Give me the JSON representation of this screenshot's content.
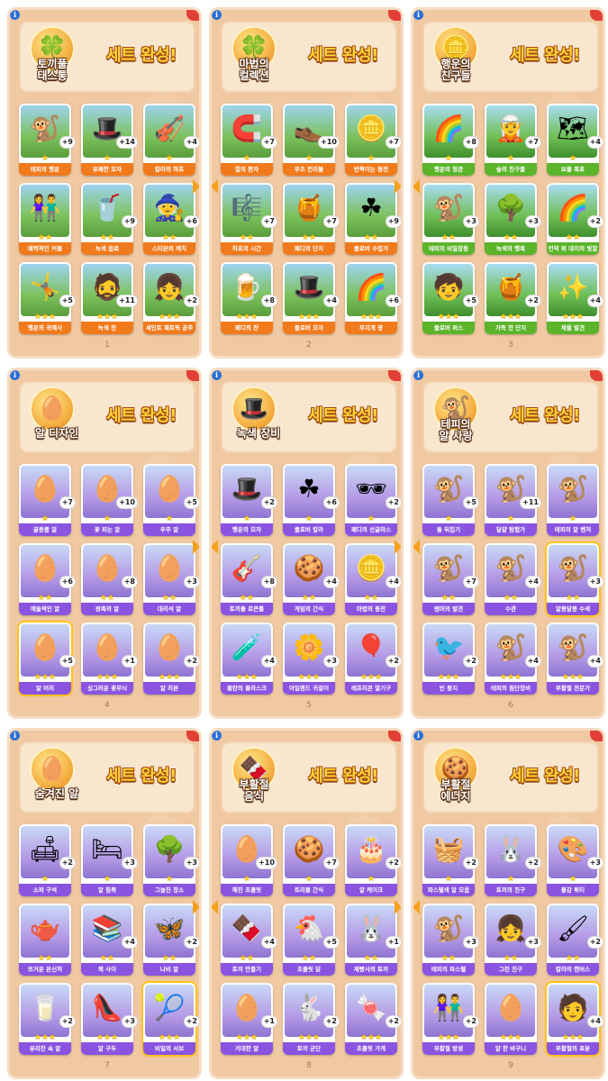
{
  "complete_label": "세트 완성!",
  "star": "★",
  "panels": [
    {
      "page": "1",
      "set_name": "토끼풀\n태스통",
      "icon": "leprechaun-duo-icon",
      "glyph": "🍀",
      "cards": [
        {
          "name": "테피의 행운",
          "dup": "+9",
          "stars": 1,
          "color": "orange",
          "emoji": "🐒",
          "gold": false
        },
        {
          "name": "유쾌한 모자",
          "dup": "+14",
          "stars": 1,
          "color": "orange",
          "emoji": "🎩",
          "gold": false
        },
        {
          "name": "칼라의 하프",
          "dup": "+4",
          "stars": 1,
          "color": "orange",
          "emoji": "🎻",
          "gold": false
        },
        {
          "name": "매력적인 커플",
          "dup": "",
          "stars": 2,
          "color": "orange",
          "emoji": "👫",
          "gold": false
        },
        {
          "name": "녹색 음료",
          "dup": "+9",
          "stars": 2,
          "color": "orange",
          "emoji": "🥤",
          "gold": false
        },
        {
          "name": "스티븐의 캐치",
          "dup": "+6",
          "stars": 2,
          "color": "orange",
          "emoji": "🧙",
          "gold": false
        },
        {
          "name": "행운의 곡예사",
          "dup": "+5",
          "stars": 3,
          "color": "orange",
          "emoji": "🤸",
          "gold": false
        },
        {
          "name": "녹색 잔",
          "dup": "+11",
          "stars": 3,
          "color": "orange",
          "emoji": "🧔",
          "gold": false
        },
        {
          "name": "세인트 패트릭 공주",
          "dup": "+2",
          "stars": 3,
          "color": "orange",
          "emoji": "👧",
          "gold": false
        }
      ]
    },
    {
      "page": "2",
      "set_name": "마법의\n컬렉션",
      "icon": "four-leaf-clover-icon",
      "glyph": "🍀",
      "cards": [
        {
          "name": "힘의 편자",
          "dup": "+7",
          "stars": 1,
          "color": "orange",
          "emoji": "🧲",
          "gold": false
        },
        {
          "name": "부츠 컨리볼",
          "dup": "+10",
          "stars": 1,
          "color": "orange",
          "emoji": "👞",
          "gold": false
        },
        {
          "name": "반짝이는 동전",
          "dup": "+7",
          "stars": 1,
          "color": "orange",
          "emoji": "🪙",
          "gold": false
        },
        {
          "name": "하프의 시간",
          "dup": "+7",
          "stars": 2,
          "color": "orange",
          "emoji": "🎼",
          "gold": false
        },
        {
          "name": "패디의 단지",
          "dup": "+7",
          "stars": 2,
          "color": "orange",
          "emoji": "🍯",
          "gold": false
        },
        {
          "name": "클로버 수집가",
          "dup": "+9",
          "stars": 2,
          "color": "orange",
          "emoji": "☘",
          "gold": false
        },
        {
          "name": "패디의 잔",
          "dup": "+8",
          "stars": 3,
          "color": "orange",
          "emoji": "🍺",
          "gold": false
        },
        {
          "name": "클로버 모자",
          "dup": "+4",
          "stars": 3,
          "color": "orange",
          "emoji": "🎩",
          "gold": false
        },
        {
          "name": "무지개 광",
          "dup": "+6",
          "stars": 3,
          "color": "orange",
          "emoji": "🌈",
          "gold": false
        }
      ]
    },
    {
      "page": "3",
      "set_name": "행운의\n친구들",
      "icon": "pot-of-gold-icon",
      "glyph": "🪙",
      "cards": [
        {
          "name": "행운의 정관",
          "dup": "+8",
          "stars": 1,
          "color": "green",
          "emoji": "🌈",
          "gold": false
        },
        {
          "name": "숲의 친구들",
          "dup": "+7",
          "stars": 1,
          "color": "green",
          "emoji": "🧝",
          "gold": false
        },
        {
          "name": "보물 목표",
          "dup": "+4",
          "stars": 1,
          "color": "green",
          "emoji": "🗺",
          "gold": false
        },
        {
          "name": "테피의 비밀장용",
          "dup": "+3",
          "stars": 2,
          "color": "green",
          "emoji": "🐒",
          "gold": false
        },
        {
          "name": "녹색의 행복",
          "dup": "+3",
          "stars": 2,
          "color": "green",
          "emoji": "🌳",
          "gold": false
        },
        {
          "name": "언덕 위 대지의 빛깔",
          "dup": "+2",
          "stars": 2,
          "color": "green",
          "emoji": "🌈",
          "gold": false
        },
        {
          "name": "클로버 퍼스",
          "dup": "+5",
          "stars": 3,
          "color": "green",
          "emoji": "🧒",
          "gold": false
        },
        {
          "name": "가득 찬 단지",
          "dup": "+2",
          "stars": 3,
          "color": "green",
          "emoji": "🍯",
          "gold": false
        },
        {
          "name": "채을 발견",
          "dup": "+4",
          "stars": 3,
          "color": "green",
          "emoji": "✨",
          "gold": false
        }
      ]
    },
    {
      "page": "4",
      "set_name": "알 디자인",
      "icon": "decorated-egg-icon",
      "glyph": "🥚",
      "cards": [
        {
          "name": "골동품 알",
          "dup": "+7",
          "stars": 1,
          "color": "purple",
          "emoji": "🥚",
          "gold": false
        },
        {
          "name": "꽃 피는 알",
          "dup": "+10",
          "stars": 1,
          "color": "purple",
          "emoji": "🥚",
          "gold": false
        },
        {
          "name": "우주 알",
          "dup": "+5",
          "stars": 1,
          "color": "purple",
          "emoji": "🥚",
          "gold": false
        },
        {
          "name": "예술적인 알",
          "dup": "+6",
          "stars": 2,
          "color": "purple",
          "emoji": "🥚",
          "gold": false
        },
        {
          "name": "왕족의 알",
          "dup": "+8",
          "stars": 2,
          "color": "purple",
          "emoji": "🥚",
          "gold": false
        },
        {
          "name": "대리석 알",
          "dup": "+3",
          "stars": 2,
          "color": "purple",
          "emoji": "🥚",
          "gold": false
        },
        {
          "name": "알 머리",
          "dup": "+5",
          "stars": 3,
          "color": "purple",
          "emoji": "🥚",
          "gold": true
        },
        {
          "name": "싱그러운 꽃무늬",
          "dup": "+1",
          "stars": 3,
          "color": "purple",
          "emoji": "🥚",
          "gold": false
        },
        {
          "name": "알 리본",
          "dup": "+2",
          "stars": 3,
          "color": "purple",
          "emoji": "🥚",
          "gold": false
        }
      ]
    },
    {
      "page": "5",
      "set_name": "녹색 장비",
      "icon": "green-hat-icon",
      "glyph": "🎩",
      "cards": [
        {
          "name": "행운의 모자",
          "dup": "+2",
          "stars": 1,
          "color": "purple",
          "emoji": "🎩",
          "gold": false
        },
        {
          "name": "클로버 칼라",
          "dup": "+6",
          "stars": 1,
          "color": "purple",
          "emoji": "☘",
          "gold": false
        },
        {
          "name": "패디의 선글라스",
          "dup": "+2",
          "stars": 1,
          "color": "purple",
          "emoji": "🕶",
          "gold": false
        },
        {
          "name": "토끼풀 로큰롤",
          "dup": "+8",
          "stars": 2,
          "color": "purple",
          "emoji": "🎸",
          "gold": false
        },
        {
          "name": "게임의 간식",
          "dup": "+4",
          "stars": 2,
          "color": "purple",
          "emoji": "🍪",
          "gold": false
        },
        {
          "name": "마법의 동전",
          "dup": "+4",
          "stars": 2,
          "color": "purple",
          "emoji": "🪙",
          "gold": false
        },
        {
          "name": "플란의 플라스크",
          "dup": "+4",
          "stars": 3,
          "color": "purple",
          "emoji": "🧪",
          "gold": false
        },
        {
          "name": "아일랜드 귀걸이",
          "dup": "+3",
          "stars": 3,
          "color": "purple",
          "emoji": "🌼",
          "gold": false
        },
        {
          "name": "레프리콘 열기구",
          "dup": "+2",
          "stars": 3,
          "color": "purple",
          "emoji": "🎈",
          "gold": false
        }
      ]
    },
    {
      "page": "6",
      "set_name": "테피의\n알 사랑",
      "icon": "monkey-painter-icon",
      "glyph": "🐒",
      "cards": [
        {
          "name": "돌 뒤집기",
          "dup": "+5",
          "stars": 1,
          "color": "purple",
          "emoji": "🐒",
          "gold": false
        },
        {
          "name": "달걀 탐험가",
          "dup": "+11",
          "stars": 1,
          "color": "purple",
          "emoji": "🐒",
          "gold": false
        },
        {
          "name": "테피의 알 벤처",
          "dup": "",
          "stars": 1,
          "color": "purple",
          "emoji": "🐒",
          "gold": false
        },
        {
          "name": "썸머의 발견",
          "dup": "+7",
          "stars": 2,
          "color": "purple",
          "emoji": "🐒",
          "gold": false
        },
        {
          "name": "수관",
          "dup": "+4",
          "stars": 2,
          "color": "purple",
          "emoji": "🐒",
          "gold": false
        },
        {
          "name": "알몽달몽 수색",
          "dup": "+3",
          "stars": 2,
          "color": "purple",
          "emoji": "🐒",
          "gold": true
        },
        {
          "name": "빈 둥지",
          "dup": "+2",
          "stars": 3,
          "color": "purple",
          "emoji": "🐦",
          "gold": false
        },
        {
          "name": "테피의 첨단장비",
          "dup": "+4",
          "stars": 3,
          "color": "purple",
          "emoji": "🐒",
          "gold": false
        },
        {
          "name": "부활절 전문가",
          "dup": "+4",
          "stars": 3,
          "color": "purple",
          "emoji": "🐒",
          "gold": false
        }
      ]
    },
    {
      "page": "7",
      "set_name": "숨겨진 알",
      "icon": "hidden-egg-icon",
      "glyph": "🥚",
      "cards": [
        {
          "name": "소파 구석",
          "dup": "+2",
          "stars": 1,
          "color": "purple",
          "emoji": "🛋",
          "gold": false
        },
        {
          "name": "알 침묵",
          "dup": "+3",
          "stars": 1,
          "color": "purple",
          "emoji": "🛏",
          "gold": false
        },
        {
          "name": "그늘진 장소",
          "dup": "+3",
          "stars": 1,
          "color": "purple",
          "emoji": "🌳",
          "gold": false
        },
        {
          "name": "뜨거운 온신처",
          "dup": "",
          "stars": 2,
          "color": "purple",
          "emoji": "🫖",
          "gold": false
        },
        {
          "name": "책 사이",
          "dup": "+4",
          "stars": 2,
          "color": "purple",
          "emoji": "📚",
          "gold": false
        },
        {
          "name": "나비 알",
          "dup": "+2",
          "stars": 2,
          "color": "purple",
          "emoji": "🦋",
          "gold": false
        },
        {
          "name": "유리잔 속 알",
          "dup": "+2",
          "stars": 3,
          "color": "purple",
          "emoji": "🥛",
          "gold": false
        },
        {
          "name": "알 구두",
          "dup": "+3",
          "stars": 3,
          "color": "purple",
          "emoji": "👠",
          "gold": false
        },
        {
          "name": "비밀의 서브",
          "dup": "+2",
          "stars": 3,
          "color": "purple",
          "emoji": "🎾",
          "gold": true
        }
      ]
    },
    {
      "page": "8",
      "set_name": "부활절\n음식",
      "icon": "chocolate-bunny-icon",
      "glyph": "🍫",
      "cards": [
        {
          "name": "해진 초콜릿",
          "dup": "+10",
          "stars": 1,
          "color": "purple",
          "emoji": "🥚",
          "gold": false
        },
        {
          "name": "트리플 간식",
          "dup": "+7",
          "stars": 1,
          "color": "purple",
          "emoji": "🍪",
          "gold": false
        },
        {
          "name": "알 케이크",
          "dup": "+2",
          "stars": 1,
          "color": "purple",
          "emoji": "🎂",
          "gold": false
        },
        {
          "name": "토끼 만들기",
          "dup": "+4",
          "stars": 2,
          "color": "purple",
          "emoji": "🍫",
          "gold": false
        },
        {
          "name": "초콜릿 닭",
          "dup": "+5",
          "stars": 2,
          "color": "purple",
          "emoji": "🐔",
          "gold": false
        },
        {
          "name": "제빵사의 토끼",
          "dup": "+1",
          "stars": 2,
          "color": "purple",
          "emoji": "🐰",
          "gold": false
        },
        {
          "name": "거대한 알",
          "dup": "+1",
          "stars": 3,
          "color": "purple",
          "emoji": "🥚",
          "gold": false
        },
        {
          "name": "토끼 군단",
          "dup": "+2",
          "stars": 3,
          "color": "purple",
          "emoji": "🐇",
          "gold": false
        },
        {
          "name": "초콜릿 가게",
          "dup": "+2",
          "stars": 3,
          "color": "purple",
          "emoji": "🍬",
          "gold": false
        }
      ]
    },
    {
      "page": "9",
      "set_name": "부활절\n에너지",
      "icon": "gingerbread-monkey-icon",
      "glyph": "🍪",
      "cards": [
        {
          "name": "파스텔색 알 모음",
          "dup": "+2",
          "stars": 1,
          "color": "purple",
          "emoji": "🧺",
          "gold": false
        },
        {
          "name": "토끼의 친구",
          "dup": "+2",
          "stars": 1,
          "color": "purple",
          "emoji": "🐰",
          "gold": false
        },
        {
          "name": "물감 튀티",
          "dup": "+3",
          "stars": 1,
          "color": "purple",
          "emoji": "🎨",
          "gold": false
        },
        {
          "name": "테피의 파스텔",
          "dup": "+3",
          "stars": 2,
          "color": "purple",
          "emoji": "🐒",
          "gold": false
        },
        {
          "name": "그린 친구",
          "dup": "+3",
          "stars": 2,
          "color": "purple",
          "emoji": "👧",
          "gold": false
        },
        {
          "name": "칼라의 캔버스",
          "dup": "+2",
          "stars": 2,
          "color": "purple",
          "emoji": "🖌",
          "gold": false
        },
        {
          "name": "부활절 방생",
          "dup": "+2",
          "stars": 3,
          "color": "purple",
          "emoji": "👫",
          "gold": false
        },
        {
          "name": "알 한 바구니",
          "dup": "",
          "stars": 3,
          "color": "purple",
          "emoji": "🥚",
          "gold": false
        },
        {
          "name": "부활절의 호분",
          "dup": "+4",
          "stars": 3,
          "color": "purple",
          "emoji": "🧑",
          "gold": true
        }
      ]
    }
  ]
}
